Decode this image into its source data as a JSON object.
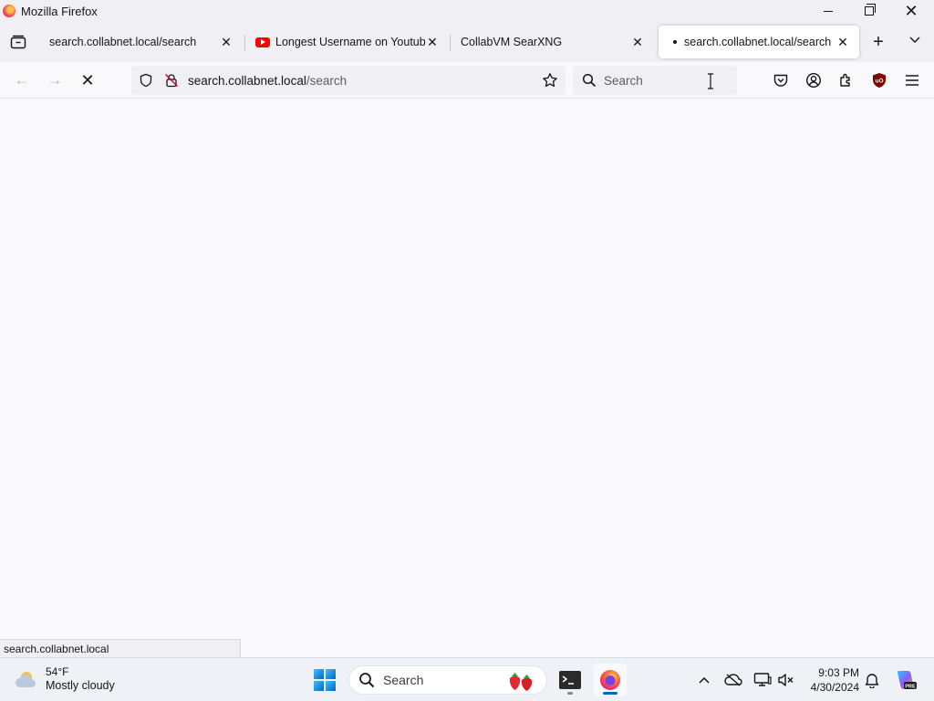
{
  "window": {
    "title": "Mozilla Firefox"
  },
  "tabs": [
    {
      "label": "search.collabnet.local/search",
      "icon": "none",
      "active": false
    },
    {
      "label": "Longest Username on Youtube",
      "icon": "youtube-icon",
      "active": false
    },
    {
      "label": "CollabVM SearXNG",
      "icon": "none",
      "active": false
    },
    {
      "label": "search.collabnet.local/search",
      "icon": "dot-icon",
      "active": true
    }
  ],
  "navbar": {
    "url_host": "search.collabnet.local",
    "url_path": "/search",
    "search_placeholder": "Search"
  },
  "status": {
    "text": "search.collabnet.local"
  },
  "taskbar": {
    "weather_temp": "54°F",
    "weather_condition": "Mostly cloudy",
    "search_label": "Search",
    "time": "9:03 PM",
    "date": "4/30/2024"
  },
  "colors": {
    "accent": "#0078d4",
    "youtube": "#ff0000",
    "ublock": "#800000",
    "content_bg": "#f9f9fb",
    "chrome_bg": "#f0f0f4"
  }
}
